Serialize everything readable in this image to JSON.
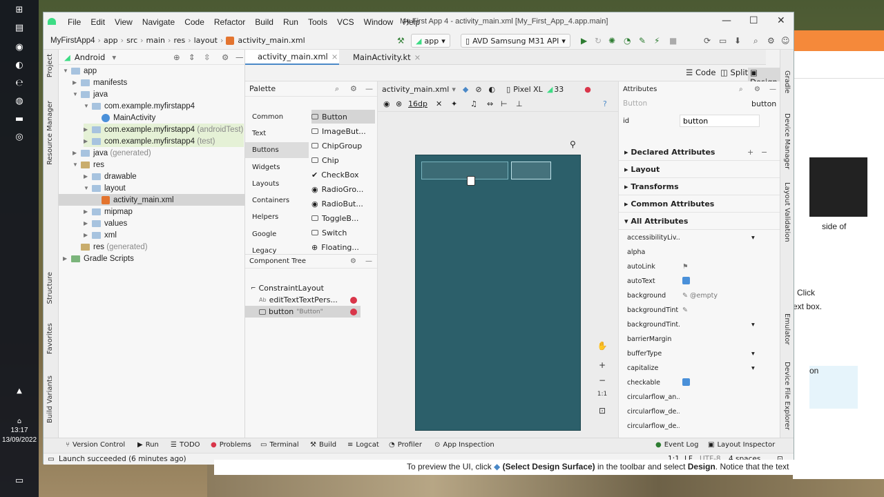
{
  "window": {
    "title": "My First App 4 - activity_main.xml [My_First_App_4.app.main]",
    "menu": [
      "File",
      "Edit",
      "View",
      "Navigate",
      "Code",
      "Refactor",
      "Build",
      "Run",
      "Tools",
      "VCS",
      "Window",
      "Help"
    ]
  },
  "navbar": {
    "breadcrumb": [
      "MyFirstApp4",
      "app",
      "src",
      "main",
      "res",
      "layout",
      "activity_main.xml"
    ],
    "run_config": "app",
    "device": "AVD Samsung M31 API"
  },
  "side_tabs_left": [
    "Project",
    "Resource Manager",
    "Structure",
    "Favorites",
    "Build Variants"
  ],
  "side_tabs_right": [
    "Gradle",
    "Device Manager",
    "Layout Validation",
    "Emulator",
    "Device File Explorer"
  ],
  "project": {
    "view": "Android",
    "tree": [
      {
        "label": "app",
        "suffix": ""
      },
      {
        "label": "manifests",
        "suffix": ""
      },
      {
        "label": "java",
        "suffix": ""
      },
      {
        "label": "com.example.myfirstapp4",
        "suffix": ""
      },
      {
        "label": "MainActivity",
        "suffix": ""
      },
      {
        "label": "com.example.myfirstapp4",
        "suffix": "(androidTest)"
      },
      {
        "label": "com.example.myfirstapp4",
        "suffix": "(test)"
      },
      {
        "label": "java",
        "suffix": "(generated)"
      },
      {
        "label": "res",
        "suffix": ""
      },
      {
        "label": "drawable",
        "suffix": ""
      },
      {
        "label": "layout",
        "suffix": ""
      },
      {
        "label": "activity_main.xml",
        "suffix": ""
      },
      {
        "label": "mipmap",
        "suffix": ""
      },
      {
        "label": "values",
        "suffix": ""
      },
      {
        "label": "xml",
        "suffix": ""
      },
      {
        "label": "res",
        "suffix": "(generated)"
      },
      {
        "label": "Gradle Scripts",
        "suffix": ""
      }
    ]
  },
  "editor_tabs": [
    "activity_main.xml",
    "MainActivity.kt"
  ],
  "modes": [
    "Code",
    "Split",
    "Design"
  ],
  "palette": {
    "title": "Palette",
    "categories": [
      "Common",
      "Text",
      "Buttons",
      "Widgets",
      "Layouts",
      "Containers",
      "Helpers",
      "Google",
      "Legacy"
    ],
    "items": [
      "Button",
      "ImageBut...",
      "ChipGroup",
      "Chip",
      "CheckBox",
      "RadioGro...",
      "RadioBut...",
      "ToggleB...",
      "Switch",
      "Floating..."
    ]
  },
  "component_tree": {
    "title": "Component Tree",
    "root": "ConstraintLayout",
    "children": [
      {
        "label": "editTextTextPers...",
        "hint": ""
      },
      {
        "label": "button",
        "hint": "\"Button\""
      }
    ]
  },
  "surface": {
    "file": "activity_main.xml",
    "margin": "16dp",
    "device": "Pixel XL",
    "api": "33",
    "zoom_ratio": "1:1"
  },
  "attributes": {
    "title": "Attributes",
    "component_type": "Button",
    "component_id": "button",
    "id_label": "id",
    "id_value": "button",
    "sections": [
      "Declared Attributes",
      "Layout",
      "Transforms",
      "Common Attributes",
      "All Attributes"
    ],
    "rows": [
      {
        "name": "accessibilityLiv...",
        "value": ""
      },
      {
        "name": "alpha",
        "value": ""
      },
      {
        "name": "autoLink",
        "value": ""
      },
      {
        "name": "autoText",
        "value": ""
      },
      {
        "name": "background",
        "value": "@empty"
      },
      {
        "name": "backgroundTint",
        "value": ""
      },
      {
        "name": "backgroundTint...",
        "value": ""
      },
      {
        "name": "barrierMargin",
        "value": ""
      },
      {
        "name": "bufferType",
        "value": ""
      },
      {
        "name": "capitalize",
        "value": ""
      },
      {
        "name": "checkable",
        "value": ""
      },
      {
        "name": "circularflow_an...",
        "value": ""
      },
      {
        "name": "circularflow_de...",
        "value": ""
      },
      {
        "name": "circularflow_de...",
        "value": ""
      }
    ]
  },
  "bottom_tools": [
    "Version Control",
    "Run",
    "TODO",
    "Problems",
    "Terminal",
    "Build",
    "Logcat",
    "Profiler",
    "App Inspection",
    "Event Log",
    "Layout Inspector"
  ],
  "status": {
    "message": "Launch succeeded (6 minutes ago)",
    "position": "1:1",
    "line_sep": "LF",
    "encoding": "UTF-8",
    "indent": "4 spaces"
  },
  "taskbar": {
    "time": "13:17",
    "date": "13/09/2022"
  },
  "browser": {
    "snippets": [
      "side of",
      "Click",
      "ext box.",
      "on"
    ],
    "caption_parts": [
      "To preview the UI, click ",
      "(Select Design Surface)",
      " in the toolbar and select ",
      "Design",
      ". Notice that the text"
    ]
  },
  "colors": {
    "accent": "#4a88c7",
    "design_bg": "#2c5f6a",
    "error": "#d9364a",
    "run_green": "#2e7d32"
  }
}
